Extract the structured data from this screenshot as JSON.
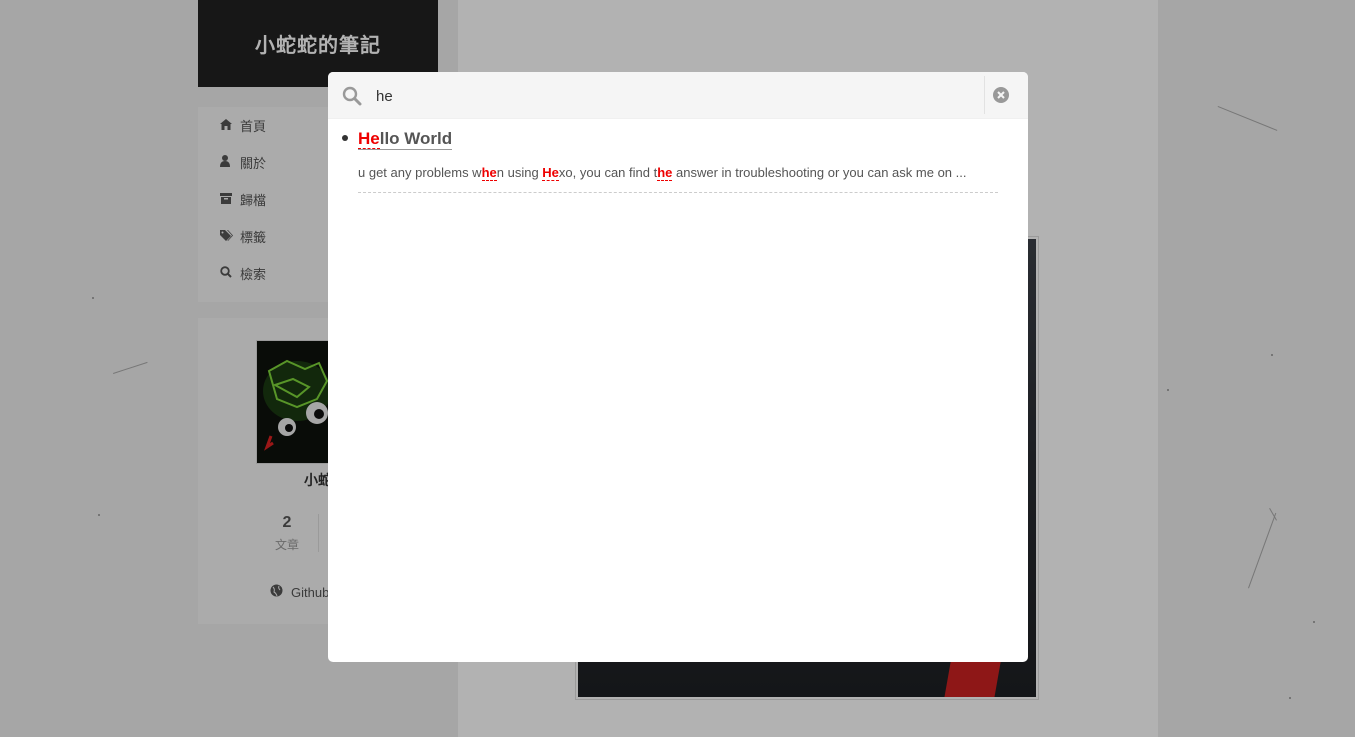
{
  "site": {
    "title": "小蛇蛇的筆記"
  },
  "menu": [
    {
      "icon": "home-icon",
      "label": "首頁"
    },
    {
      "icon": "user-icon",
      "label": "關於"
    },
    {
      "icon": "archive-icon",
      "label": "歸檔"
    },
    {
      "icon": "tags-icon",
      "label": "標籤"
    },
    {
      "icon": "search-icon",
      "label": "檢索"
    }
  ],
  "profile": {
    "author_partial": "小蛇",
    "posts_count": "2",
    "posts_label": "文章",
    "github_label": "Github"
  },
  "search": {
    "query": "he",
    "results": [
      {
        "title_parts": [
          {
            "text": "He",
            "highlight": true
          },
          {
            "text": "llo World",
            "highlight": false
          }
        ],
        "excerpt_parts": [
          {
            "text": "u get any problems w",
            "highlight": false
          },
          {
            "text": "he",
            "highlight": true
          },
          {
            "text": "n using ",
            "highlight": false
          },
          {
            "text": "He",
            "highlight": true
          },
          {
            "text": "xo, you can find t",
            "highlight": false
          },
          {
            "text": "he",
            "highlight": true
          },
          {
            "text": " answer in troubleshooting or you can ask me on ...",
            "highlight": false
          }
        ]
      }
    ]
  },
  "colors": {
    "highlight": "#ee0000",
    "brand_bg": "#222222",
    "overlay": "rgba(0,0,0,0.3)"
  }
}
